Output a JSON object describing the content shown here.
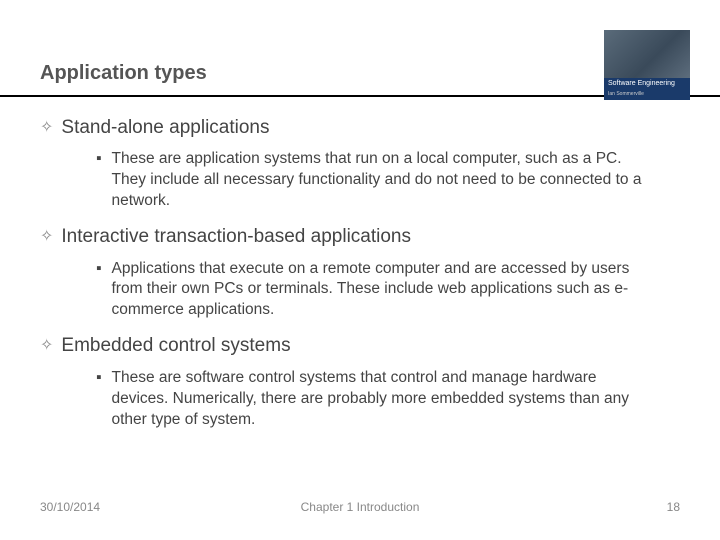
{
  "title": "Application types",
  "logo": {
    "label": "Software Engineering",
    "sublabel": "Ian Sommerville"
  },
  "items": [
    {
      "heading": "Stand-alone applications",
      "sub": "These are application systems that run on a local computer, such as a PC. They include all necessary functionality and do not need to be connected to a network."
    },
    {
      "heading": "Interactive transaction-based applications",
      "sub": "Applications that execute on a remote computer and are accessed by users from their own PCs or terminals. These include web applications such as e-commerce applications."
    },
    {
      "heading": "Embedded control systems",
      "sub": "These are software control systems that control and manage hardware devices. Numerically, there are probably more embedded systems than any other type of system."
    }
  ],
  "footer": {
    "date": "30/10/2014",
    "chapter": "Chapter 1 Introduction",
    "page": "18"
  }
}
